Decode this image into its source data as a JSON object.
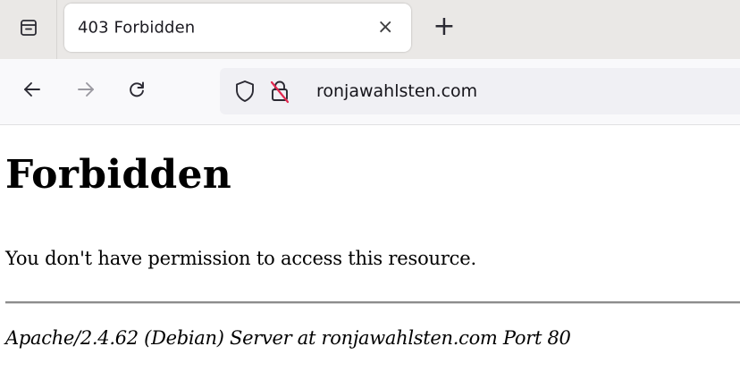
{
  "tab": {
    "title": "403 Forbidden",
    "close_glyph": "×"
  },
  "new_tab_glyph": "+",
  "nav": {
    "back_icon": "arrow-left-icon",
    "forward_icon": "arrow-right-icon",
    "reload_icon": "reload-icon"
  },
  "urlbar": {
    "url": "ronjawahlsten.com",
    "shield_icon": "shield-icon",
    "lock_icon": "insecure-lock-icon",
    "insecure_color": "#e22850"
  },
  "page": {
    "heading": "Forbidden",
    "message": "You don't have permission to access this resource.",
    "server_info": "Apache/2.4.62 (Debian) Server at ronjawahlsten.com Port 80"
  }
}
